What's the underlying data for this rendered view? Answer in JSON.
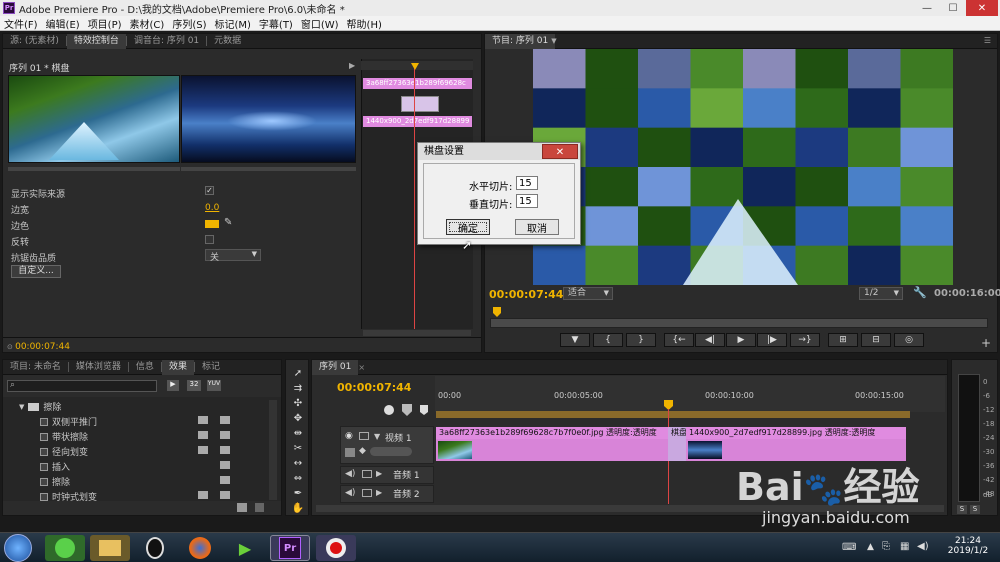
{
  "window": {
    "title": "Adobe Premiere Pro - D:\\我的文档\\Adobe\\Premiere Pro\\6.0\\未命名 *",
    "app_badge": "Pr"
  },
  "menu": [
    "文件(F)",
    "编辑(E)",
    "项目(P)",
    "素材(C)",
    "序列(S)",
    "标记(M)",
    "字幕(T)",
    "窗口(W)",
    "帮助(H)"
  ],
  "effect_panel": {
    "tabs": [
      "源: (无素材)",
      "特效控制台",
      "调音台: 序列 01",
      "元数据"
    ],
    "active_tab": 1,
    "header": "序列 01 * 棋盘",
    "clip1_label": "3a68ff27363e1b289f69628c",
    "clip2_label": "1440x900_2d7edf917d28899",
    "props": [
      {
        "label": "显示实际来源",
        "value": "✓"
      },
      {
        "label": "边宽",
        "value": "0.0"
      },
      {
        "label": "边色",
        "value": ""
      },
      {
        "label": "反转",
        "value": ""
      },
      {
        "label": "抗锯齿品质",
        "value": "关"
      }
    ],
    "custom_button": "自定义...",
    "timecode": "00:00:07:44"
  },
  "program": {
    "title": "节目: 序列 01",
    "timecode": "00:00:07:44",
    "fit": "适合",
    "resolution": "1/2",
    "duration": "00:00:16:00",
    "buttons": [
      "▼",
      "{",
      "}",
      "{←",
      "◀|",
      "▶",
      "|▶",
      "→}",
      "⊞",
      "⊟",
      "◎"
    ]
  },
  "project_panel": {
    "tabs": [
      "项目: 未命名",
      "媒体浏览器",
      "信息",
      "效果",
      "标记"
    ],
    "active_tab": 3,
    "folder": "擦除",
    "items": [
      "双侧平推门",
      "带状擦除",
      "径向划变",
      "插入",
      "擦除",
      "时钟式划变"
    ]
  },
  "timeline": {
    "tab": "序列 01",
    "timecode": "00:00:07:44",
    "ruler": [
      "00:00",
      "00:00:05:00",
      "00:00:10:00",
      "00:00:15:00"
    ],
    "video_track": "视频 1",
    "audio_tracks": [
      "音频 1",
      "音频 2"
    ],
    "clip1": "3a68ff27363e1b289f69628c7b7f0e0f.jpg",
    "clip1_fx": "透明度:透明度",
    "transition": "棋盘",
    "clip2": "1440x900_2d7edf917d28899.jpg",
    "clip2_fx": "透明度:透明度"
  },
  "meter": {
    "labels": [
      "0",
      "-6",
      "-12",
      "-18",
      "-24",
      "-30",
      "-36",
      "-42",
      "-48",
      "dB"
    ],
    "solo": [
      "S",
      "S"
    ]
  },
  "dialog": {
    "title": "棋盘设置",
    "h_label": "水平切片:",
    "h_value": "15",
    "v_label": "垂直切片:",
    "v_value": "15",
    "ok": "确定",
    "cancel": "取消"
  },
  "taskbar": {
    "time": "21:24",
    "date": "2019/1/2"
  },
  "watermark": {
    "brand": "Bai",
    "brand2": "经验",
    "url": "jingyan.baidu.com"
  },
  "colors": {
    "accent": "#f0b400",
    "clip_pink": "#e08be0",
    "playhead": "#d44"
  }
}
